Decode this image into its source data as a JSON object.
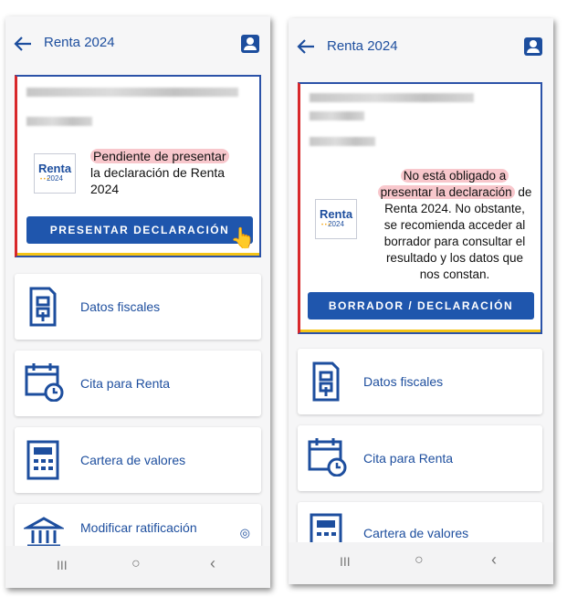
{
  "left": {
    "title": "Renta 2024",
    "logo": {
      "word": "Renta",
      "year": "2024"
    },
    "message_highlight": "Pendiente de presentar",
    "message_rest_1": "la declaración de Renta",
    "message_rest_2": "2024",
    "button": "PRESENTAR DECLARACIÓN",
    "menu": [
      {
        "label": "Datos fiscales",
        "icon": "tax-document-icon"
      },
      {
        "label": "Cita para Renta",
        "icon": "calendar-clock-icon"
      },
      {
        "label": "Cartera de valores",
        "icon": "portfolio-grid-icon"
      },
      {
        "label": "Modificar ratificación",
        "icon": "bank-icon"
      }
    ],
    "nav": {
      "recents": "III",
      "home": "○",
      "back": "‹"
    }
  },
  "right": {
    "title": "Renta 2024",
    "logo": {
      "word": "Renta",
      "year": "2024"
    },
    "message_highlight_1": "No está obligado a",
    "message_highlight_2": "presentar la declaración",
    "message_line2_tail": " de",
    "message_line3": "Renta 2024. No obstante,",
    "message_line4": "se recomienda acceder al",
    "message_line5": "borrador para consultar el",
    "message_line6": "resultado y los datos que",
    "message_line7": "nos constan.",
    "button": "BORRADOR / DECLARACIÓN",
    "menu": [
      {
        "label": "Datos fiscales",
        "icon": "tax-document-icon"
      },
      {
        "label": "Cita para Renta",
        "icon": "calendar-clock-icon"
      },
      {
        "label": "Cartera de valores",
        "icon": "portfolio-grid-icon"
      }
    ],
    "nav": {
      "recents": "III",
      "home": "○",
      "back": "‹"
    }
  },
  "colors": {
    "brand_blue": "#1d4e9e",
    "button_blue": "#1f56ad",
    "accent_red": "#d8282b",
    "accent_yellow": "#f4c417",
    "highlight_pink": "#f8c7cc"
  }
}
